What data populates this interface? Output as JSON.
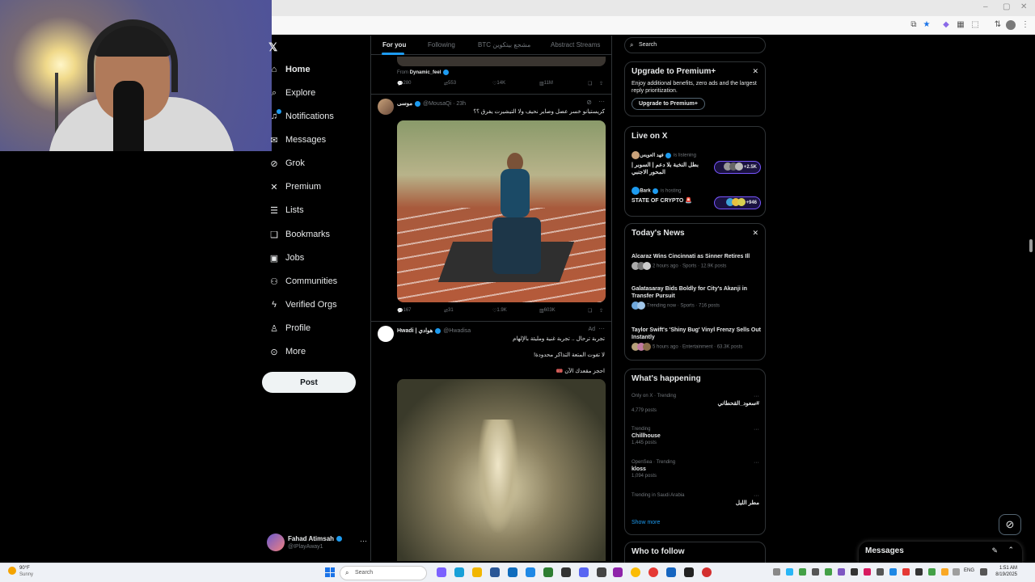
{
  "nav": {
    "items": [
      {
        "label": "Home",
        "icon": "home-icon"
      },
      {
        "label": "Explore",
        "icon": "search-icon"
      },
      {
        "label": "Notifications",
        "icon": "bell-icon"
      },
      {
        "label": "Messages",
        "icon": "mail-icon"
      },
      {
        "label": "Grok",
        "icon": "grok-icon"
      },
      {
        "label": "Premium",
        "icon": "x-logo-icon"
      },
      {
        "label": "Lists",
        "icon": "list-icon"
      },
      {
        "label": "Bookmarks",
        "icon": "bookmark-icon"
      },
      {
        "label": "Jobs",
        "icon": "briefcase-icon"
      },
      {
        "label": "Communities",
        "icon": "people-icon"
      },
      {
        "label": "Verified Orgs",
        "icon": "lightning-icon"
      },
      {
        "label": "Profile",
        "icon": "person-icon"
      },
      {
        "label": "More",
        "icon": "more-circle-icon"
      }
    ],
    "post_label": "Post",
    "account": {
      "name": "Fahad Atimsah",
      "handle": "@IPlayAway1"
    }
  },
  "feed": {
    "tabs": [
      "For you",
      "Following",
      "BTC مشجع بيتكوين",
      "Abstract Streams"
    ],
    "prev_post": {
      "from_prefix": "From",
      "from_user": "Dynamic_feel",
      "replies": "280",
      "reposts": "553",
      "likes": "14K",
      "views": "11M"
    },
    "tweet": {
      "name": "موسى",
      "handle": "@MousaQi",
      "time": "23h",
      "text": "كريستيانو خسر عضل وصاير نحيف ولا التيشيرت يفرق ؟؟",
      "replies": "167",
      "reposts": "31",
      "likes": "1.9K",
      "views": "603K"
    },
    "ad": {
      "name": "Hwadi | هوادي",
      "handle": "@Hwadisa",
      "ad_label": "Ad",
      "line1": "تجربة ترحال .. تجربة غنية ومليئة بالإلهام",
      "line2": "لا تفوت المتعة التذاكر محدودة!",
      "line3": "احجز مقعدك الآن 🎟️"
    }
  },
  "right": {
    "search_placeholder": "Search",
    "premium": {
      "title": "Upgrade to Premium+",
      "desc": "Enjoy additional benefits, zero ads and the largest reply prioritization.",
      "button": "Upgrade to Premium+"
    },
    "live": {
      "title": "Live on X",
      "items": [
        {
          "host": "فهد العويس",
          "status": "is listening",
          "title": "بطل النخبة بلا دعم | السوبر | المحور الاجنبي",
          "count": "+2.5K"
        },
        {
          "host": "Bark",
          "status": "is hosting",
          "title": "STATE OF CRYPTO 🚨",
          "count": "+946"
        }
      ]
    },
    "news": {
      "title": "Today's News",
      "items": [
        {
          "title": "Alcaraz Wins Cincinnati as Sinner Retires Ill",
          "meta": "2 hours ago · Sports · 12.9K posts"
        },
        {
          "title": "Galatasaray Bids Boldly for City's Akanji in Transfer Pursuit",
          "meta": "Trending now · Sports · 716 posts"
        },
        {
          "title": "Taylor Swift's 'Shiny Bug' Vinyl Frenzy Sells Out Instantly",
          "meta": "5 hours ago · Entertainment · 63.3K posts"
        }
      ]
    },
    "happening": {
      "title": "What's happening",
      "items": [
        {
          "context": "Only on X · Trending",
          "name": "#سعود_القحطاني",
          "count": "4,779 posts",
          "rtl": true
        },
        {
          "context": "Trending",
          "name": "Chillhouse",
          "count": "1,445 posts",
          "rtl": false
        },
        {
          "context": "OpenSea · Trending",
          "name": "kloss",
          "count": "1,094 posts",
          "rtl": false
        },
        {
          "context": "Trending in Saudi Arabia",
          "name": "مطر الليل",
          "count": "",
          "rtl": true
        }
      ],
      "show_more": "Show more"
    },
    "who_to_follow": "Who to follow"
  },
  "messages_drawer": {
    "label": "Messages"
  },
  "taskbar": {
    "weather_temp": "90°F",
    "weather_desc": "Sunny",
    "search_placeholder": "Search",
    "lang": "ENG",
    "time": "1:51 AM",
    "date": "8/19/2025"
  },
  "colors": {
    "accent": "#1d9bf0",
    "background": "#000000",
    "border": "#2f3336",
    "muted": "#71767b"
  }
}
